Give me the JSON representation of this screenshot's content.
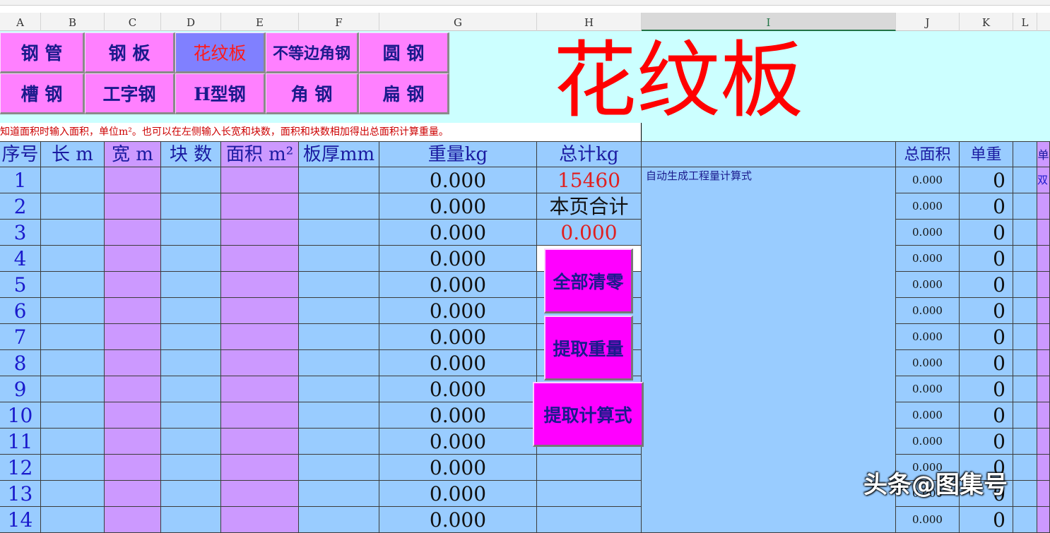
{
  "columns": [
    "A",
    "B",
    "C",
    "D",
    "E",
    "F",
    "G",
    "H",
    "I",
    "J",
    "K",
    "L"
  ],
  "selected_column": "I",
  "nav_buttons": [
    {
      "label": "钢 管"
    },
    {
      "label": "钢 板"
    },
    {
      "label": "花纹板",
      "active": true
    },
    {
      "label": "不等边角钢"
    },
    {
      "label": "圆 钢"
    },
    {
      "label": "槽 钢"
    },
    {
      "label": "工字钢"
    },
    {
      "label": "H型钢"
    },
    {
      "label": "角 钢"
    },
    {
      "label": "扁 钢"
    }
  ],
  "title": "花纹板",
  "note": "知道面积时输入面积，单位m²。也可以在左侧输入长宽和块数，面积和块数相加得出总面积计算重量。",
  "headers": {
    "seq": "序号",
    "length": "长 m",
    "width": "宽 m",
    "count": "块 数",
    "area": "面积 m²",
    "thickness": "板厚mm",
    "weight": "重量kg",
    "total": "总计kg",
    "total_area": "总面积",
    "unit_weight": "单重",
    "extra": "单"
  },
  "summary": {
    "total_value": "15460",
    "page_total_label": "本页合计",
    "page_total_value": "0.000",
    "formula_label": "自动生成工程量计算式",
    "extra_text": "双"
  },
  "actions": {
    "clear": "全部清零",
    "extract_weight": "提取重量",
    "extract_formula": "提取计算式"
  },
  "rows": [
    {
      "seq": "1",
      "weight": "0.000",
      "total_area": "0.000",
      "unit_weight": "0"
    },
    {
      "seq": "2",
      "weight": "0.000",
      "total_area": "0.000",
      "unit_weight": "0"
    },
    {
      "seq": "3",
      "weight": "0.000",
      "total_area": "0.000",
      "unit_weight": "0"
    },
    {
      "seq": "4",
      "weight": "0.000",
      "total_area": "0.000",
      "unit_weight": "0"
    },
    {
      "seq": "5",
      "weight": "0.000",
      "total_area": "0.000",
      "unit_weight": "0"
    },
    {
      "seq": "6",
      "weight": "0.000",
      "total_area": "0.000",
      "unit_weight": "0"
    },
    {
      "seq": "7",
      "weight": "0.000",
      "total_area": "0.000",
      "unit_weight": "0"
    },
    {
      "seq": "8",
      "weight": "0.000",
      "total_area": "0.000",
      "unit_weight": "0"
    },
    {
      "seq": "9",
      "weight": "0.000",
      "total_area": "0.000",
      "unit_weight": "0"
    },
    {
      "seq": "10",
      "weight": "0.000",
      "total_area": "0.000",
      "unit_weight": "0"
    },
    {
      "seq": "11",
      "weight": "0.000",
      "total_area": "0.000",
      "unit_weight": "0"
    },
    {
      "seq": "12",
      "weight": "0.000",
      "total_area": "0.000",
      "unit_weight": "0"
    },
    {
      "seq": "13",
      "weight": "0.000",
      "total_area": "0.000",
      "unit_weight": "0"
    },
    {
      "seq": "14",
      "weight": "0.000",
      "total_area": "0.000",
      "unit_weight": "0"
    }
  ],
  "watermark": "头条@图集号",
  "colors": {
    "nav": "#ff80ff",
    "nav_active": "#8080ff",
    "title": "#ff0000",
    "action": "#ff00ff",
    "grid_blue": "#99ccff",
    "grid_purple": "#cc99ff",
    "top_bg": "#ccffff"
  }
}
